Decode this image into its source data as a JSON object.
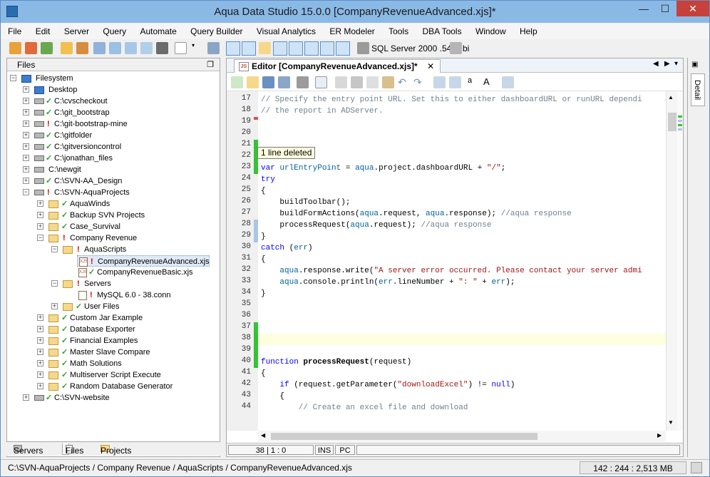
{
  "window": {
    "title": "Aqua Data Studio 15.0.0 [CompanyRevenueAdvanced.xjs]*",
    "minimize": "—",
    "maximize": "☐",
    "close": "✕"
  },
  "menu": [
    "File",
    "Edit",
    "Server",
    "Query",
    "Automate",
    "Query Builder",
    "Visual Analytics",
    "ER Modeler",
    "Tools",
    "DBA Tools",
    "Window",
    "Help"
  ],
  "toolbar": {
    "server_label": "SQL Server 2000 .54",
    "db_label": "bi"
  },
  "files_panel": {
    "title": "Files",
    "items": [
      {
        "label": "Filesystem",
        "icon": "monitor-icon",
        "status": ""
      },
      {
        "label": "Desktop",
        "icon": "monitor-icon",
        "status": ""
      },
      {
        "label": "C:\\cvscheckout",
        "icon": "drive-icon",
        "status": "ok"
      },
      {
        "label": "C:\\git_bootstrap",
        "icon": "drive-icon",
        "status": "ok"
      },
      {
        "label": "C:\\git-bootstrap-mine",
        "icon": "drive-icon",
        "status": "!"
      },
      {
        "label": "C:\\gitfolder",
        "icon": "drive-icon",
        "status": "ok"
      },
      {
        "label": "C:\\gitversioncontrol",
        "icon": "drive-icon",
        "status": "ok"
      },
      {
        "label": "C:\\jonathan_files",
        "icon": "drive-icon",
        "status": "ok"
      },
      {
        "label": "C:\\newgit",
        "icon": "drive-icon",
        "status": ""
      },
      {
        "label": "C:\\SVN-AA_Design",
        "icon": "drive-icon",
        "status": "ok"
      },
      {
        "label": "C:\\SVN-AquaProjects",
        "icon": "drive-icon",
        "status": "!"
      },
      {
        "label": "AquaWinds",
        "icon": "folder-icon",
        "status": "ok"
      },
      {
        "label": "Backup SVN Projects",
        "icon": "folder-icon",
        "status": "ok"
      },
      {
        "label": "Case_Survival",
        "icon": "folder-icon",
        "status": "ok"
      },
      {
        "label": "Company Revenue",
        "icon": "folder-icon",
        "status": "!"
      },
      {
        "label": "AquaScripts",
        "icon": "folder-icon",
        "status": "!"
      },
      {
        "label": "CompanyRevenueAdvanced.xjs",
        "icon": "file-icon",
        "status": "!"
      },
      {
        "label": "CompanyRevenueBasic.xjs",
        "icon": "file-icon",
        "status": "ok"
      },
      {
        "label": "Servers",
        "icon": "folder-icon",
        "status": "!"
      },
      {
        "label": "MySQL 6.0 - 38.conn",
        "icon": "file-icon",
        "status": "!"
      },
      {
        "label": "User Files",
        "icon": "folder-icon",
        "status": "ok"
      },
      {
        "label": "Custom Jar Example",
        "icon": "folder-icon",
        "status": "ok"
      },
      {
        "label": "Database Exporter",
        "icon": "folder-icon",
        "status": "ok"
      },
      {
        "label": "Financial Examples",
        "icon": "folder-icon",
        "status": "ok"
      },
      {
        "label": "Master Slave Compare",
        "icon": "folder-icon",
        "status": "ok"
      },
      {
        "label": "Math Solutions",
        "icon": "folder-icon",
        "status": "ok"
      },
      {
        "label": "Multiserver Script Execute",
        "icon": "folder-icon",
        "status": "ok"
      },
      {
        "label": "Random Database Generator",
        "icon": "folder-icon",
        "status": "ok"
      },
      {
        "label": "C:\\SVN-website",
        "icon": "drive-icon",
        "status": "ok"
      }
    ],
    "bottom_tabs": [
      "Servers",
      "Files",
      "Projects"
    ]
  },
  "editor": {
    "tab_label": "Editor [CompanyRevenueAdvanced.xjs]*",
    "tooltip": "1 line deleted",
    "cursor_pos": "38 | 1 : 0",
    "mode_ins": "INS",
    "mode_pc": "PC",
    "lines": [
      {
        "n": "17",
        "text": "// Specify the entry point URL. Set this to either dashboardURL or runURL dependi",
        "type": "comment"
      },
      {
        "n": "18",
        "text": "// the report in ADServer.",
        "type": "comment"
      },
      {
        "n": "19",
        "text": "",
        "type": "plain"
      },
      {
        "n": "20",
        "text": "",
        "type": "plain"
      },
      {
        "n": "21",
        "text": "",
        "type": "plain"
      },
      {
        "n": "22",
        "text": "",
        "type": "plain"
      },
      {
        "n": "23",
        "text": "var urlEntryPoint = aqua.project.dashboardURL + \"/\";",
        "type": "line23"
      },
      {
        "n": "24",
        "text": "try",
        "type": "kw"
      },
      {
        "n": "25",
        "text": "{",
        "type": "plain"
      },
      {
        "n": "26",
        "text": "    buildToolbar();",
        "type": "plain"
      },
      {
        "n": "27",
        "text": "    buildFormActions(aqua.request, aqua.response); //aqua response",
        "type": "line27"
      },
      {
        "n": "28",
        "text": "    processRequest(aqua.request); //aqua response",
        "type": "line28"
      },
      {
        "n": "29",
        "text": "}",
        "type": "plain"
      },
      {
        "n": "30",
        "text": "catch (err)",
        "type": "line30"
      },
      {
        "n": "31",
        "text": "{",
        "type": "plain"
      },
      {
        "n": "32",
        "text": "    aqua.response.write(\"A server error occurred. Please contact your server admi",
        "type": "line32"
      },
      {
        "n": "33",
        "text": "    aqua.console.println(err.lineNumber + \": \" + err);",
        "type": "line33"
      },
      {
        "n": "34",
        "text": "}",
        "type": "plain"
      },
      {
        "n": "35",
        "text": "",
        "type": "plain"
      },
      {
        "n": "36",
        "text": "",
        "type": "plain"
      },
      {
        "n": "37",
        "text": "",
        "type": "plain"
      },
      {
        "n": "38",
        "text": "",
        "type": "plain"
      },
      {
        "n": "39",
        "text": "",
        "type": "plain"
      },
      {
        "n": "40",
        "text": "function processRequest(request)",
        "type": "line40"
      },
      {
        "n": "41",
        "text": "{",
        "type": "plain"
      },
      {
        "n": "42",
        "text": "    if (request.getParameter(\"downloadExcel\") != null)",
        "type": "line42"
      },
      {
        "n": "43",
        "text": "    {",
        "type": "plain"
      },
      {
        "n": "44",
        "text": "        // Create an excel file and download",
        "type": "comment"
      }
    ]
  },
  "detail_tab": "Detail",
  "status": {
    "path": "C:\\SVN-AquaProjects / Company Revenue / AquaScripts / CompanyRevenueAdvanced.xjs",
    "memory": "142 : 244 : 2,513 MB"
  },
  "colors": {
    "added": "#33c433",
    "modified": "#a9c6ea",
    "deleted": "#e05050",
    "currentline": "#ffffe0"
  }
}
